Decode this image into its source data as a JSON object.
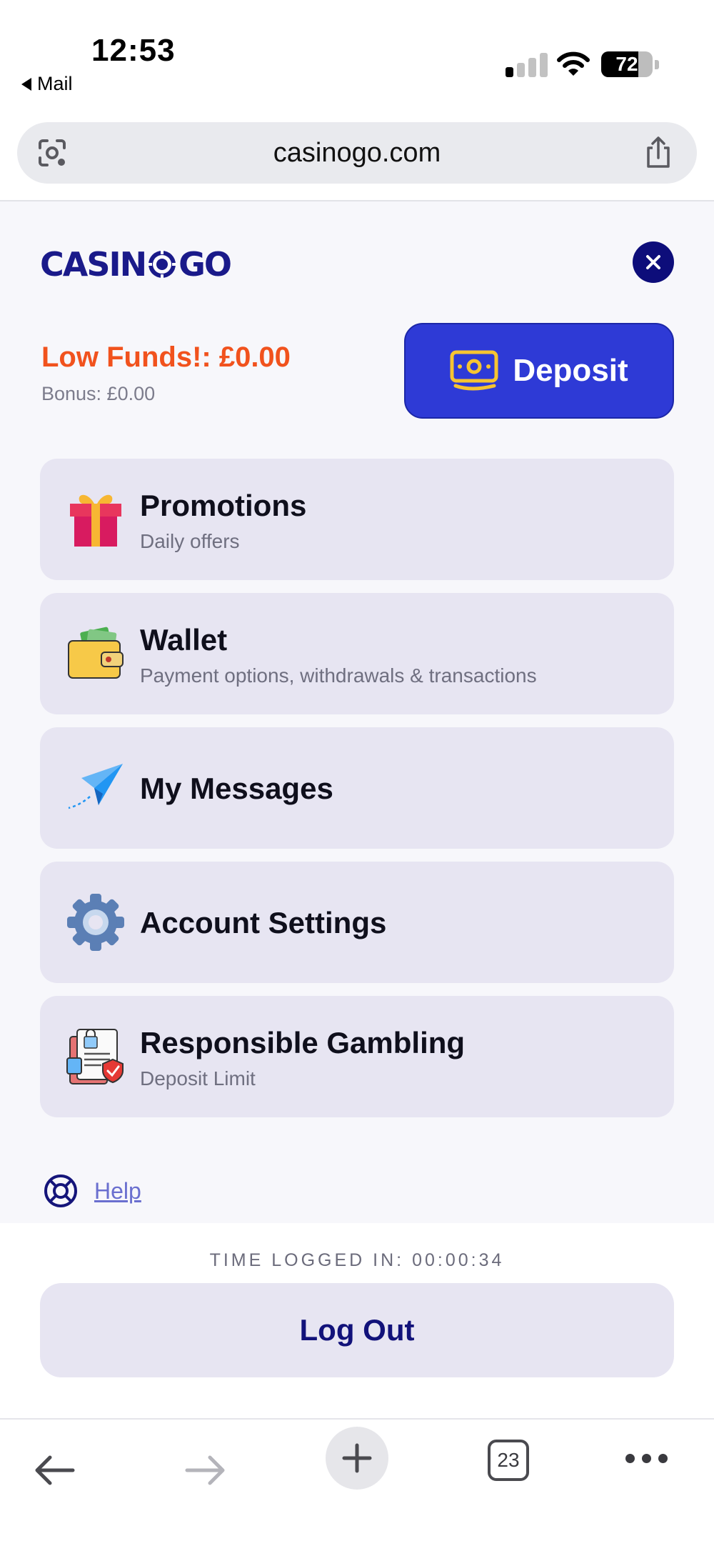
{
  "status_bar": {
    "time": "12:53",
    "back_app": "Mail",
    "battery": "72"
  },
  "browser": {
    "url": "casinogo.com",
    "tab_count": "23"
  },
  "menu": {
    "logo": {
      "left": "CASIN",
      "right": "GO"
    },
    "funds_text": "Low Funds!: £0.00",
    "bonus_text": "Bonus: £0.00",
    "deposit_label": "Deposit",
    "items": [
      {
        "title": "Promotions",
        "subtitle": "Daily offers",
        "icon": "gift-icon"
      },
      {
        "title": "Wallet",
        "subtitle": "Payment options, withdrawals & transactions",
        "icon": "wallet-icon"
      },
      {
        "title": "My Messages",
        "subtitle": "",
        "icon": "paper-plane-icon"
      },
      {
        "title": "Account Settings",
        "subtitle": "",
        "icon": "gear-icon"
      },
      {
        "title": "Responsible Gambling",
        "subtitle": "Deposit Limit",
        "icon": "document-shield-icon"
      }
    ],
    "help_label": "Help"
  },
  "footer": {
    "timer_text": "TIME LOGGED IN: 00:00:34",
    "logout_label": "Log Out"
  },
  "colors": {
    "brand_navy": "#0d0d7a",
    "deposit_blue": "#2e3ad6",
    "low_funds_orange": "#f1521d",
    "item_bg": "#e7e5f2"
  }
}
